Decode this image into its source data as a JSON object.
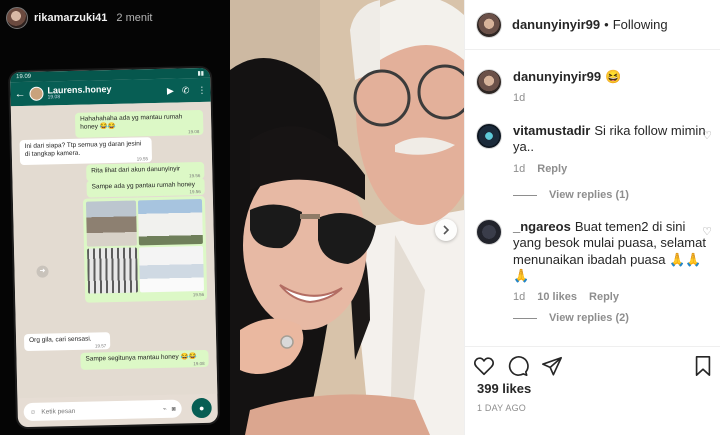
{
  "story": {
    "username": "rikamarzuki41",
    "time": "2 menit",
    "phone": {
      "clock": "19.09",
      "contact_name": "Laurens.honey",
      "contact_sub": "19.08",
      "messages": [
        {
          "dir": "out",
          "text": "Hahahahaha ada yg mantau rumah honey",
          "emoji": "😂😂",
          "time": "19.08"
        },
        {
          "dir": "in",
          "text": "Ini dari siapa? Ttp semua yg daran jesini di tangkap kamera.",
          "emoji": "",
          "time": "19.55"
        },
        {
          "dir": "out",
          "text": "Rita lihat dari akun danunyinyir",
          "emoji": "",
          "time": "19.56"
        },
        {
          "dir": "out",
          "text": "Sampe ada yg pantau rumah honey",
          "emoji": "",
          "time": "19.56"
        },
        {
          "dir": "in",
          "text": "Org gila, cari sensasi.",
          "emoji": "",
          "time": "19.57"
        },
        {
          "dir": "out",
          "text": "Sampe segitunya mantau honey",
          "emoji": "😂😂",
          "time": "19.08"
        }
      ],
      "image_time": "19.56",
      "input_placeholder": "Ketik pesan"
    }
  },
  "post": {
    "header": {
      "username": "danunyinyir99",
      "separator": "•",
      "follow_status": "Following"
    },
    "caption": {
      "username": "danunyinyir99",
      "text": "😆",
      "age": "1d"
    },
    "comments": [
      {
        "username": "vitamustadir",
        "text": "Si rika follow mimin ya..",
        "age": "1d",
        "likes": "",
        "reply_label": "Reply",
        "view_replies": "View replies (1)"
      },
      {
        "username": "_ngareos",
        "text": "Buat temen2 di sini yang besok mulai puasa, selamat menunaikan ibadah puasa 🙏🙏🙏",
        "age": "1d",
        "likes": "10 likes",
        "reply_label": "Reply",
        "view_replies": "View replies (2)"
      }
    ],
    "likes": "399 likes",
    "posted": "1 DAY AGO",
    "colors": {
      "text": "#262626",
      "muted": "#8e8e8e",
      "whatsapp_green": "#075e54"
    }
  }
}
